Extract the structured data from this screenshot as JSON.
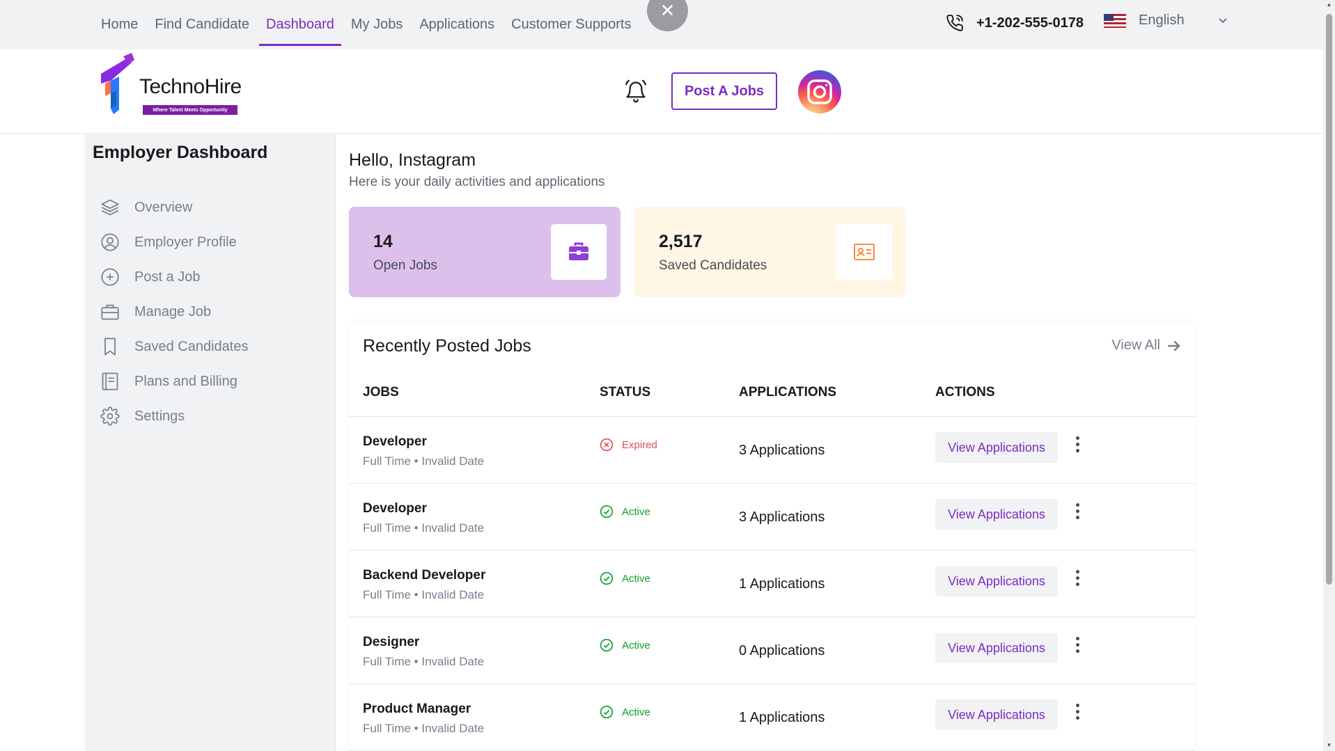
{
  "topnav": {
    "items": [
      {
        "label": "Home"
      },
      {
        "label": "Find Candidate"
      },
      {
        "label": "Dashboard"
      },
      {
        "label": "My Jobs"
      },
      {
        "label": "Applications"
      },
      {
        "label": "Customer Supports"
      }
    ],
    "active_index": 2,
    "phone": "+1-202-555-0178",
    "language": "English",
    "close_symbol": "✕"
  },
  "header": {
    "logo_name": "TechnoHire",
    "logo_tagline": "Where Talent Meets Opportunity",
    "post_button": "Post A Jobs"
  },
  "sidebar": {
    "title": "Employer Dashboard",
    "items": [
      {
        "label": "Overview",
        "icon": "layers-icon"
      },
      {
        "label": "Employer Profile",
        "icon": "user-circle-icon"
      },
      {
        "label": "Post a Job",
        "icon": "plus-circle-icon"
      },
      {
        "label": "Manage Job",
        "icon": "briefcase-icon"
      },
      {
        "label": "Saved Candidates",
        "icon": "bookmark-icon"
      },
      {
        "label": "Plans and Billing",
        "icon": "receipt-icon"
      },
      {
        "label": "Settings",
        "icon": "gear-icon"
      }
    ]
  },
  "main": {
    "greeting": "Hello, Instagram",
    "subtitle": "Here is your daily activities and applications",
    "stats": [
      {
        "value": "14",
        "label": "Open Jobs",
        "icon": "briefcase-icon",
        "color": "#dcc0eb"
      },
      {
        "value": "2,517",
        "label": "Saved Candidates",
        "icon": "id-card-icon",
        "color": "#fff6e6"
      }
    ],
    "jobs_title": "Recently Posted Jobs",
    "view_all": "View All",
    "columns": [
      "JOBS",
      "STATUS",
      "APPLICATIONS",
      "ACTIONS"
    ],
    "view_button": "View Applications",
    "rows": [
      {
        "title": "Developer",
        "meta": "Full Time • Invalid Date",
        "status": "Expired",
        "applications": "3 Applications"
      },
      {
        "title": "Developer",
        "meta": "Full Time • Invalid Date",
        "status": "Active",
        "applications": "3 Applications"
      },
      {
        "title": "Backend Developer",
        "meta": "Full Time • Invalid Date",
        "status": "Active",
        "applications": "1 Applications"
      },
      {
        "title": "Designer",
        "meta": "Full Time • Invalid Date",
        "status": "Active",
        "applications": "0 Applications"
      },
      {
        "title": "Product Manager",
        "meta": "Full Time • Invalid Date",
        "status": "Active",
        "applications": "1 Applications"
      }
    ]
  },
  "colors": {
    "accent": "#7b2cbf",
    "active": "#0ba02c",
    "expired": "#e05151"
  }
}
